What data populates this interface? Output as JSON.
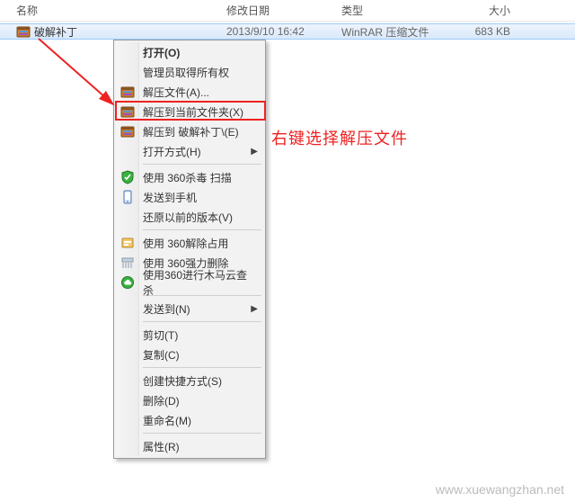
{
  "header": {
    "name": "名称",
    "date": "修改日期",
    "type": "类型",
    "size": "大小"
  },
  "file": {
    "name": "破解补丁",
    "date": "2013/9/10 16:42",
    "type": "WinRAR 压缩文件",
    "size": "683 KB",
    "icon": "rar-icon"
  },
  "menu": {
    "items": [
      {
        "label": "打开(O)",
        "icon": "",
        "bold": true,
        "sub": false
      },
      {
        "label": "管理员取得所有权",
        "icon": "",
        "bold": false,
        "sub": false
      },
      {
        "label": "解压文件(A)...",
        "icon": "rar-icon",
        "bold": false,
        "sub": false
      },
      {
        "label": "解压到当前文件夹(X)",
        "icon": "rar-icon",
        "bold": false,
        "sub": false
      },
      {
        "label": "解压到 破解补丁\\(E)",
        "icon": "rar-icon",
        "bold": false,
        "sub": false
      },
      {
        "label": "打开方式(H)",
        "icon": "",
        "bold": false,
        "sub": true
      },
      {
        "sep": true
      },
      {
        "label": "使用 360杀毒 扫描",
        "icon": "shield-icon",
        "bold": false,
        "sub": false
      },
      {
        "label": "发送到手机",
        "icon": "phone-icon",
        "bold": false,
        "sub": false
      },
      {
        "label": "还原以前的版本(V)",
        "icon": "",
        "bold": false,
        "sub": false
      },
      {
        "sep": true
      },
      {
        "label": "使用 360解除占用",
        "icon": "unlock-icon",
        "bold": false,
        "sub": false
      },
      {
        "label": "使用 360强力删除",
        "icon": "shred-icon",
        "bold": false,
        "sub": false
      },
      {
        "label": "使用360进行木马云查杀",
        "icon": "cloud-icon",
        "bold": false,
        "sub": false
      },
      {
        "sep": true
      },
      {
        "label": "发送到(N)",
        "icon": "",
        "bold": false,
        "sub": true
      },
      {
        "sep": true
      },
      {
        "label": "剪切(T)",
        "icon": "",
        "bold": false,
        "sub": false
      },
      {
        "label": "复制(C)",
        "icon": "",
        "bold": false,
        "sub": false
      },
      {
        "sep": true
      },
      {
        "label": "创建快捷方式(S)",
        "icon": "",
        "bold": false,
        "sub": false
      },
      {
        "label": "删除(D)",
        "icon": "",
        "bold": false,
        "sub": false
      },
      {
        "label": "重命名(M)",
        "icon": "",
        "bold": false,
        "sub": false
      },
      {
        "sep": true
      },
      {
        "label": "属性(R)",
        "icon": "",
        "bold": false,
        "sub": false
      }
    ]
  },
  "annotation": {
    "text": "右键选择解压文件"
  },
  "watermark": "www.xuewangzhan.net"
}
